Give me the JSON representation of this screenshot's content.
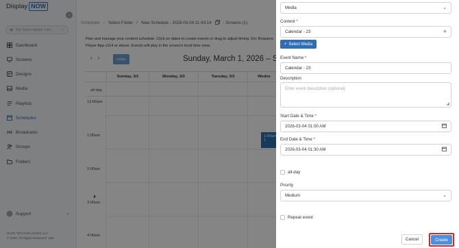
{
  "sidebar": {
    "logo_text": "Display",
    "logo_badge": "NOW",
    "subscription_placeholder": "My Subscription Lite...",
    "items": [
      {
        "label": "Dashboard"
      },
      {
        "label": "Screens"
      },
      {
        "label": "Designs"
      },
      {
        "label": "Media"
      },
      {
        "label": "Playlists"
      },
      {
        "label": "Schedules",
        "active": true
      },
      {
        "label": "Broadcasts"
      },
      {
        "label": "Groups"
      },
      {
        "label": "Folders"
      }
    ],
    "support_label": "Support",
    "copyright_line1": "DUKE TECHNOLOGIES LLC",
    "copyright_line2": "© 2026. All Rights Reserved. V36"
  },
  "breadcrumb": {
    "scheduler": "Scheduler",
    "sep1": "›",
    "select_folder": "Select Folder",
    "sep2": "/",
    "schedule_name": "New Schedule - 2026-03-04 11:43:14",
    "screens": "- Screens (1)"
  },
  "description": "Plan and manage your content schedule. Click on dates to create events or drag to adjust timing. Drc Requires Player App v114 or above. Events will play in the screen's local time zone.",
  "calendar": {
    "today_label": "today",
    "title": "Sunday, March 1, 2026 – Sa",
    "days": [
      "Sunday, 3/1",
      "Monday, 3/2",
      "Tuesday, 3/3",
      "Wedne"
    ],
    "allday_label": "all-day",
    "times": [
      "12:00am",
      "1:00am",
      "2:00am",
      "3:00am",
      "4:00am"
    ],
    "event_label": "1:00am - 1"
  },
  "form": {
    "type_value": "Media",
    "content_label": "Content",
    "content_value": "Calendar - 23",
    "select_media_label": "Select Media",
    "event_name_label": "Event Name",
    "event_name_value": "Calendar - 23",
    "description_label": "Description",
    "description_placeholder": "Enter event description (optional)",
    "start_label": "Start Date & Time",
    "start_value": "2026-03-04 01:00 AM",
    "end_label": "End Date & Time",
    "end_value": "2026-03-04 01:30 AM",
    "allday_label": "all-day",
    "priority_label": "Priority",
    "priority_value": "Medium",
    "repeat_label": "Repeat event",
    "required_mark": "*",
    "cancel_label": "Cancel",
    "create_label": "Create"
  },
  "colors": {
    "accent": "#2f6db5",
    "create_button": "#4a8fe0",
    "highlight_outline": "#e02020"
  }
}
